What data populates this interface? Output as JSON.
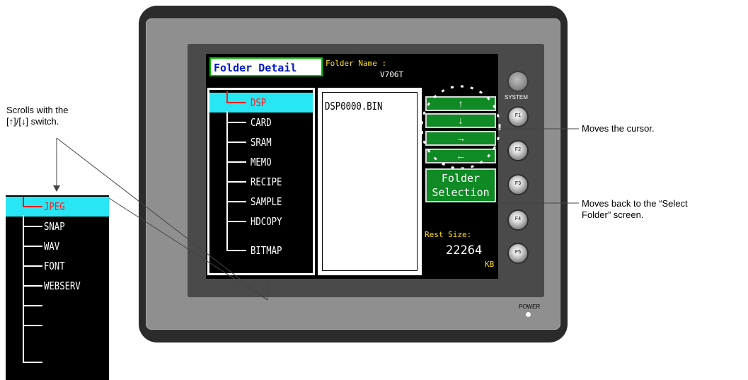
{
  "annotations": {
    "scroll_note_line1": "Scrolls with the",
    "scroll_note_line2": "[↑]/[↓] switch.",
    "cursor_note": "Moves the cursor.",
    "back_note_line1": "Moves back to the “Select",
    "back_note_line2": "Folder” screen."
  },
  "screen": {
    "title": "Folder Detail",
    "folder_name_label": "Folder Name :",
    "folder_name_value": "V706T",
    "tree_items": [
      "DSP",
      "CARD",
      "SRAM",
      "MEMO",
      "RECIPE",
      "SAMPLE",
      "HDCOPY",
      "BITMAP"
    ],
    "selected_tree_item": "DSP",
    "files": [
      "DSP0000.BIN"
    ],
    "arrow_buttons": [
      "↑",
      "↓",
      "→",
      "←"
    ],
    "folder_selection_line1": "Folder",
    "folder_selection_line2": "Selection",
    "rest_size_label": "Rest Size:",
    "rest_size_value": "22264",
    "rest_size_unit": "KB"
  },
  "hardware": {
    "system_label": "SYSTEM",
    "function_keys": [
      "F1",
      "F2",
      "F3",
      "F4",
      "F5"
    ],
    "power_label": "POWER"
  },
  "zoom_panel": {
    "items": [
      "JPEG",
      "SNAP",
      "WAV",
      "FONT",
      "WEBSERV",
      "",
      "",
      ""
    ],
    "selected_item": "JPEG"
  },
  "colors": {
    "selection_bg": "#29e6f5",
    "selection_text": "#ff1a1a",
    "button_green": "#0f8a24",
    "title_text": "#0018c8",
    "label_yellow": "#ffe000"
  }
}
